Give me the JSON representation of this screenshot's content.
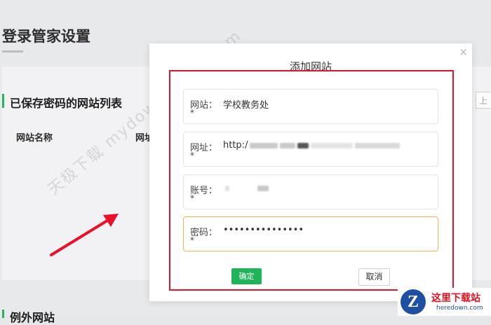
{
  "background": {
    "page_title": "登录管家设置",
    "section_title": "已保存密码的网站列表",
    "columns": [
      "网站名称",
      "网址"
    ],
    "search_placeholder": "上",
    "section2_title": "例外网站"
  },
  "watermark": "天极下载 mydown.yesky.com",
  "modal": {
    "title": "添加网站",
    "close_icon": "×",
    "fields": [
      {
        "label": "网站：",
        "required": "*",
        "value": "学校教务处"
      },
      {
        "label": "网址：",
        "required": "*",
        "value": "http:/"
      },
      {
        "label": "账号：",
        "required": "*",
        "value": ""
      },
      {
        "label": "密码：",
        "required": "*",
        "value": "•••••••••••••••"
      }
    ],
    "ok_label": "确定",
    "cancel_label": "取消"
  },
  "logo": {
    "mark": "Z",
    "name": "这里下载站",
    "domain": "heredown.com"
  },
  "colors": {
    "accent_green": "#1fb45a",
    "highlight_red": "#e0142e",
    "focus_orange": "#f0b35a"
  }
}
